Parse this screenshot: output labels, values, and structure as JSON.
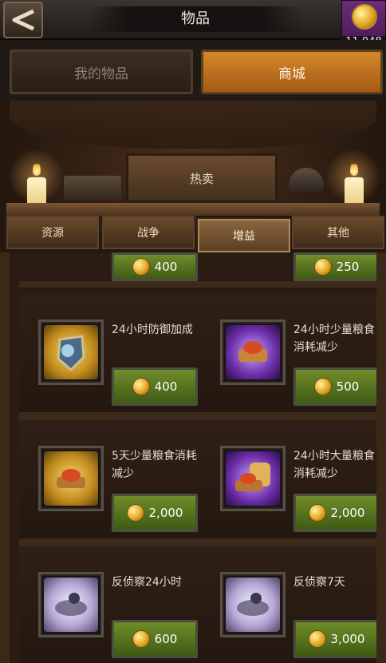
{
  "header": {
    "title": "物品",
    "gold_amount": "11,048"
  },
  "top_tabs": [
    {
      "label": "我的物品",
      "active": false
    },
    {
      "label": "商城",
      "active": true
    }
  ],
  "store": {
    "banner": "热卖",
    "categories": [
      {
        "label": "资源",
        "active": false
      },
      {
        "label": "战争",
        "active": false
      },
      {
        "label": "增益",
        "active": true
      },
      {
        "label": "其他",
        "active": false
      }
    ]
  },
  "partial_row": {
    "left_price": "400",
    "right_price": "250"
  },
  "items": [
    {
      "name": "24小时防御加成",
      "price": "400",
      "icon": "shield-icon",
      "bg": "gold"
    },
    {
      "name": "24小时少量粮食消耗减少",
      "price": "500",
      "icon": "bread-icon",
      "bg": "purple"
    },
    {
      "name": "5天少量粮食消耗减少",
      "price": "2,000",
      "icon": "bread-icon",
      "bg": "gold"
    },
    {
      "name": "24小时大量粮食消耗减少",
      "price": "2,000",
      "icon": "bread-stack-icon",
      "bg": "purple"
    },
    {
      "name": "反侦察24小时",
      "price": "600",
      "icon": "anti-scout-icon",
      "bg": "pale"
    },
    {
      "name": "反侦察7天",
      "price": "3,000",
      "icon": "anti-scout-icon",
      "bg": "pale"
    }
  ],
  "colors": {
    "accent_orange": "#c6781e",
    "price_green": "#5c7a22",
    "wood": "#3e2a1a"
  }
}
